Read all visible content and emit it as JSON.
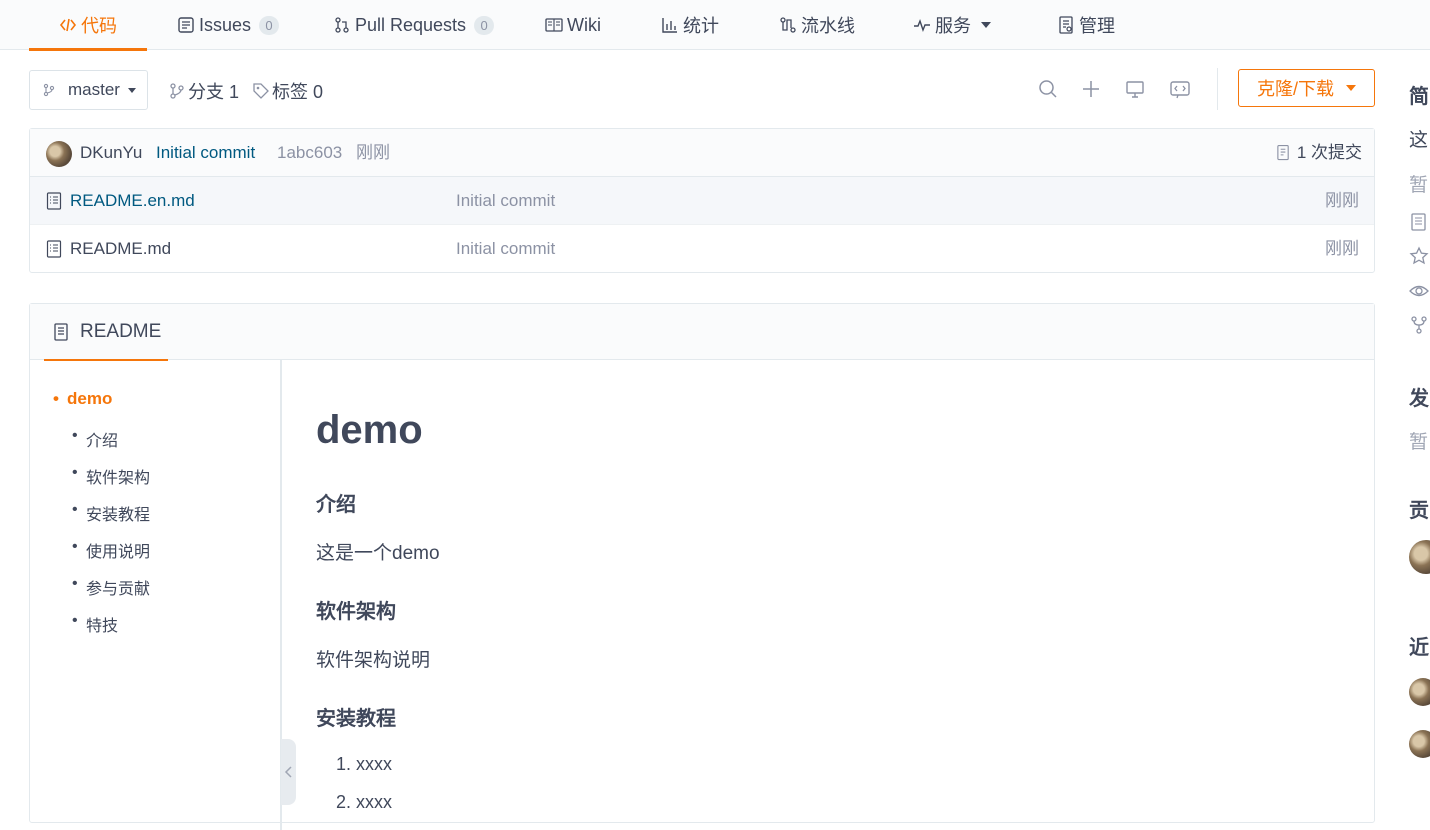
{
  "colors": {
    "accent": "#f5760b",
    "link": "#005980",
    "muted": "#8c92a4",
    "text": "#40485b"
  },
  "tabs": [
    {
      "label": "代码",
      "icon": "code-icon",
      "active": true
    },
    {
      "label": "Issues",
      "icon": "issues-icon",
      "count": "0"
    },
    {
      "label": "Pull Requests",
      "icon": "pull-request-icon",
      "count": "0"
    },
    {
      "label": "Wiki",
      "icon": "wiki-book-icon"
    },
    {
      "label": "统计",
      "icon": "bar-chart-icon"
    },
    {
      "label": "流水线",
      "icon": "pipeline-icon"
    },
    {
      "label": "服务",
      "icon": "pulse-icon",
      "dropdown": true
    },
    {
      "label": "管理",
      "icon": "manage-doc-icon"
    }
  ],
  "toolbar": {
    "branch": "master",
    "branches_label": "分支 1",
    "tags_label": "标签 0",
    "clone_label": "克隆/下载",
    "icons": [
      "search-icon",
      "plus-icon",
      "monitor-icon",
      "web-ide-icon"
    ]
  },
  "commit": {
    "author": "DKunYu",
    "message": "Initial commit",
    "hash": "1abc603",
    "time": "刚刚",
    "count_label": "1 次提交"
  },
  "files": [
    {
      "name": "README.en.md",
      "message": "Initial commit",
      "time": "刚刚"
    },
    {
      "name": "README.md",
      "message": "Initial commit",
      "time": "刚刚"
    }
  ],
  "readme": {
    "tab_label": "README",
    "toc": {
      "top": "demo",
      "items": [
        "介绍",
        "软件架构",
        "安装教程",
        "使用说明",
        "参与贡献",
        "特技"
      ]
    },
    "title": "demo",
    "sections": [
      {
        "heading": "介绍",
        "body": "这是一个demo"
      },
      {
        "heading": "软件架构",
        "body": "软件架构说明"
      },
      {
        "heading": "安装教程"
      }
    ],
    "install_steps": [
      "1. xxxx",
      "2. xxxx"
    ]
  },
  "sidebar": {
    "intro_heading": "简",
    "intro_text": "这",
    "intro_empty": "暂",
    "release_heading": "发",
    "release_empty": "暂",
    "contrib_heading": "贡",
    "recent_heading": "近"
  }
}
